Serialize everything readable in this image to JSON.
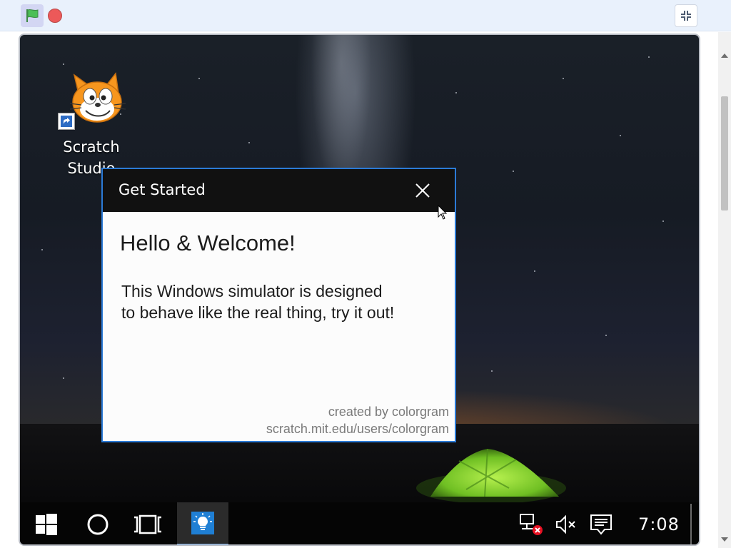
{
  "toolbar": {
    "green_flag_icon": "green-flag-icon",
    "stop_icon": "stop-icon",
    "fullscreen_icon": "exit-fullscreen-icon"
  },
  "desktop": {
    "icon_label_line1": "Scratch",
    "icon_label_line2": "Studio"
  },
  "dialog": {
    "title": "Get Started",
    "heading": "Hello & Welcome!",
    "body_line1": "This Windows simulator is designed",
    "body_line2": "to behave like the real thing, try it out!",
    "credit_line1": "created by colorgram",
    "credit_line2": "scratch.mit.edu/users/colorgram"
  },
  "taskbar": {
    "clock": "7:08"
  },
  "colors": {
    "dialog_border": "#2b7ad6",
    "taskbar_bg": "#050505",
    "stop_red": "#ec5959",
    "flag_green": "#4cbf56",
    "tent_green": "#8ce03a"
  }
}
